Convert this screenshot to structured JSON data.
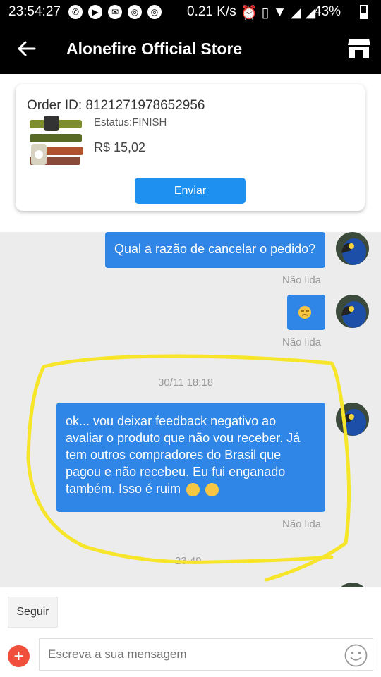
{
  "status_bar": {
    "time": "23:54:27",
    "speed": "0.21 K/s",
    "battery": "43%"
  },
  "header": {
    "title": "Alonefire Official Store"
  },
  "order": {
    "id_label": "Order ID: 8121271978652956",
    "status": "Estatus:FINISH",
    "price": "R$ 15,02",
    "send_button": "Enviar"
  },
  "messages": [
    {
      "text": "Qual a razão de cancelar o pedido?",
      "state": "Não lida"
    },
    {
      "text": "",
      "state": "Não lida"
    },
    {
      "text": "ok... vou deixar feedback negativo ao avaliar o produto que não vou receber. Já tem outros compradores do Brasil que pagou e não recebeu. Eu fui enganado também. Isso é ruim",
      "state": "Não lida"
    }
  ],
  "date_separator": "30/11 18:18",
  "time_separator": "23:49",
  "footer": {
    "follow_label": "Seguir",
    "input_placeholder": "Escreva a sua mensagem"
  },
  "colors": {
    "accent": "#2f86e6",
    "highlight": "#f7e52a",
    "plus": "#ef4f3b"
  }
}
